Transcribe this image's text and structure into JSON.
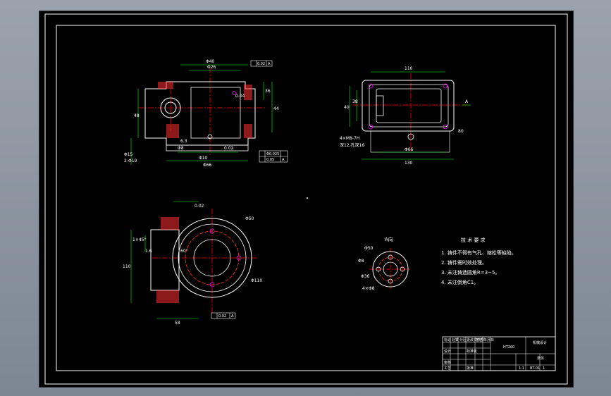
{
  "colors": {
    "background": "#000000",
    "frame": "#ffffff",
    "geometry": "#ffffff",
    "dimension": "#00ff00",
    "centerline": "#ff0000",
    "section_hatch": "#ff3030",
    "holes": "#ff00ff",
    "titleblock_text": "#ffffff",
    "window_chrome": "#8a939e"
  },
  "views": {
    "front": {
      "label_width": "Φ40",
      "label_a": "Φ26",
      "label_b": "Φ48",
      "label_flange": "Φ8",
      "label_side1": "36",
      "label_side2": "44",
      "label_side3": "48",
      "label_left1": "Φ15",
      "label_left2": "2-Φ10",
      "label_bottom": "Φ10",
      "label_bottom2": "Φ66",
      "label_tol1": "0.02",
      "label_tol2": "0.04",
      "label_r": "6.3",
      "fcf_top": "0.02",
      "fcf_top_ref": "A",
      "fcf_box1": "Φ0.025",
      "fcf_box2": "0.05",
      "fcf_box_ref": "A"
    },
    "top": {
      "label_width": "110",
      "label_height": "40",
      "label_left": "38",
      "label_bottom1": "Φ66",
      "label_bottom2": "130",
      "label_holes": "4×M8-7H",
      "label_holes2": "深12,孔深16",
      "label_a": "A",
      "label_right": "80"
    },
    "side": {
      "label_dia": "Φ50",
      "label_r": "Φ110",
      "label_height": "110",
      "label_chamfer": "1×45°",
      "label_angle": "60°",
      "label_bottom": "58",
      "label_tol": "0.02",
      "label_box": "0.02",
      "label_box_ref": "A",
      "label_ra": "1.6"
    },
    "aview": {
      "title": "A向",
      "label1": "Φ50",
      "label2": "Φ8",
      "label3": "Φ36",
      "label4": "4×Φ8"
    }
  },
  "notes": {
    "title": "技 术 要 求",
    "items": [
      "1. 铸件不得有气孔、缩松等缺陷。",
      "2. 铸件需时效处理。",
      "3. 未注铸造圆角R=3~5。",
      "4. 未注倒角C1。"
    ]
  },
  "titleblock": {
    "part_name": "泵体",
    "material": "HT200",
    "drawing_no": "BT-01",
    "company": "机械设计",
    "scale": "1:1",
    "sheet": "1",
    "header_cells": [
      "标记",
      "处数",
      "分区",
      "更改文件号",
      "签名",
      "年月日"
    ],
    "row2": [
      "设计",
      "",
      "",
      "标准化",
      "",
      ""
    ],
    "row3": [
      "审核",
      "",
      "",
      "",
      "",
      ""
    ],
    "row4": [
      "工艺",
      "",
      "",
      "批准",
      "",
      ""
    ]
  }
}
